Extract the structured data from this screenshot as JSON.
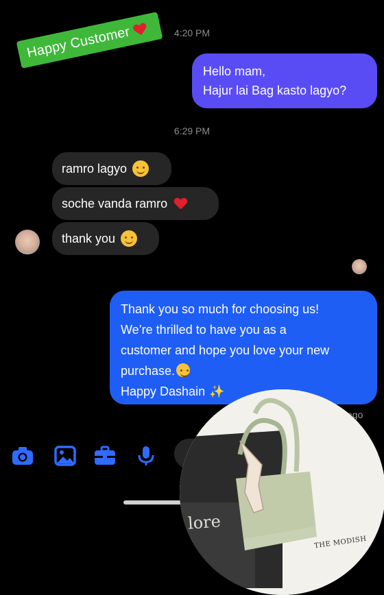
{
  "sticker": {
    "text": "Happy Customer"
  },
  "times": {
    "first": "4:20 PM",
    "second": "6:29 PM",
    "ago_suffix": "ago"
  },
  "outgoing1": {
    "lines": [
      "Hello mam,",
      "Hajur lai Bag kasto lagyo?"
    ]
  },
  "incoming": [
    {
      "text": "ramro lagyo",
      "emoji": "smiling-face"
    },
    {
      "text": "soche vanda ramro",
      "emoji": "red-heart"
    },
    {
      "text": "thank you",
      "emoji": "smiling-face"
    }
  ],
  "outgoing2": {
    "lines": [
      "Thank you so much for choosing us!",
      "We’re thrilled to have you as a",
      "customer and hope you love your new",
      "purchase.",
      "Happy Dashain"
    ]
  },
  "toolbar": {
    "icons": [
      "camera-icon",
      "gallery-icon",
      "briefcase-icon",
      "microphone-icon"
    ]
  },
  "photo": {
    "label_big": "lore",
    "label_small": "THE MODISH"
  },
  "colors": {
    "background": "#000000",
    "sticker": "#3fb83a",
    "bubble_purple": "#5a4cf5",
    "bubble_blue": "#1f5ef5",
    "bubble_gray": "#262626",
    "icon_blue": "#2f6bff"
  }
}
